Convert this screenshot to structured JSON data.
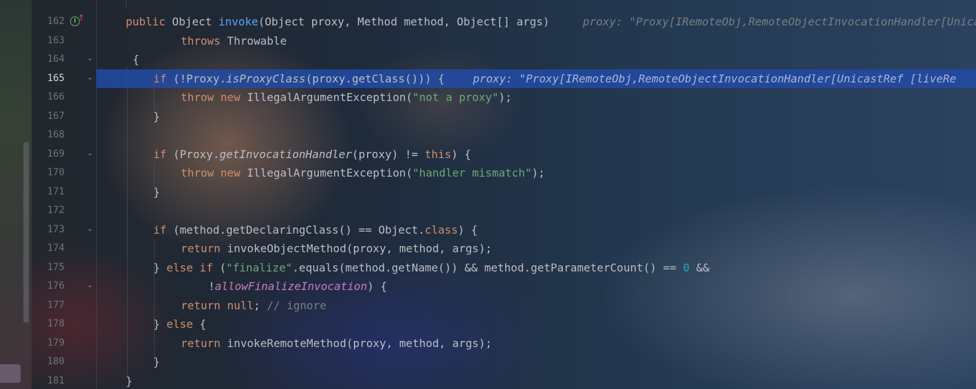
{
  "editor": {
    "colors": {
      "keyword": "#cf8e6d",
      "method_decl": "#56a8f5",
      "string": "#6aab73",
      "number": "#2aacb8",
      "comment": "#7a7e85",
      "field": "#c77dbb",
      "text": "#bcbec4",
      "caret_line": "#214ba6"
    },
    "gutter_icons": {
      "line_162": "implementation-up-icon",
      "fold": "chevron-down-icon"
    },
    "lines": [
      {
        "num": "162",
        "parts": [
          "public",
          " Object ",
          "invoke",
          "(Object proxy, Method method, Object[] args)"
        ],
        "hint": "proxy: \"Proxy[IRemoteObj,RemoteObjectInvocationHandler[Unicas"
      },
      {
        "num": "163",
        "parts": [
          "throws",
          " Throwable"
        ]
      },
      {
        "num": "164",
        "parts": [
          "{"
        ]
      },
      {
        "num": "165",
        "parts": [
          "if",
          " (!Proxy.",
          "isProxyClass",
          "(proxy.getClass())) {"
        ],
        "hint": "proxy: \"Proxy[IRemoteObj,RemoteObjectInvocationHandler[UnicastRef [liveRe"
      },
      {
        "num": "166",
        "parts": [
          "throw new",
          " IllegalArgumentException(",
          "\"not a proxy\"",
          ");"
        ]
      },
      {
        "num": "167",
        "parts": [
          "}"
        ]
      },
      {
        "num": "168",
        "parts": []
      },
      {
        "num": "169",
        "parts": [
          "if",
          " (Proxy.",
          "getInvocationHandler",
          "(proxy) != ",
          "this",
          ") {"
        ]
      },
      {
        "num": "170",
        "parts": [
          "throw new",
          " IllegalArgumentException(",
          "\"handler mismatch\"",
          ");"
        ]
      },
      {
        "num": "171",
        "parts": [
          "}"
        ]
      },
      {
        "num": "172",
        "parts": []
      },
      {
        "num": "173",
        "parts": [
          "if",
          " (method.getDeclaringClass() == Object.",
          "class",
          ") {"
        ]
      },
      {
        "num": "174",
        "parts": [
          "return",
          " invokeObjectMethod(proxy, method, args);"
        ]
      },
      {
        "num": "175",
        "parts": [
          "} ",
          "else if",
          " (",
          "\"finalize\"",
          ".equals(method.getName()) && method.getParameterCount() == ",
          "0",
          " &&"
        ]
      },
      {
        "num": "176",
        "parts": [
          "!",
          "allowFinalizeInvocation",
          ") {"
        ]
      },
      {
        "num": "177",
        "parts": [
          "return null",
          "; ",
          "// ignore"
        ]
      },
      {
        "num": "178",
        "parts": [
          "} ",
          "else",
          " {"
        ]
      },
      {
        "num": "179",
        "parts": [
          "return",
          " invokeRemoteMethod(proxy, method, args);"
        ]
      },
      {
        "num": "180",
        "parts": [
          "}"
        ]
      },
      {
        "num": "181",
        "parts": [
          "}"
        ]
      }
    ]
  }
}
